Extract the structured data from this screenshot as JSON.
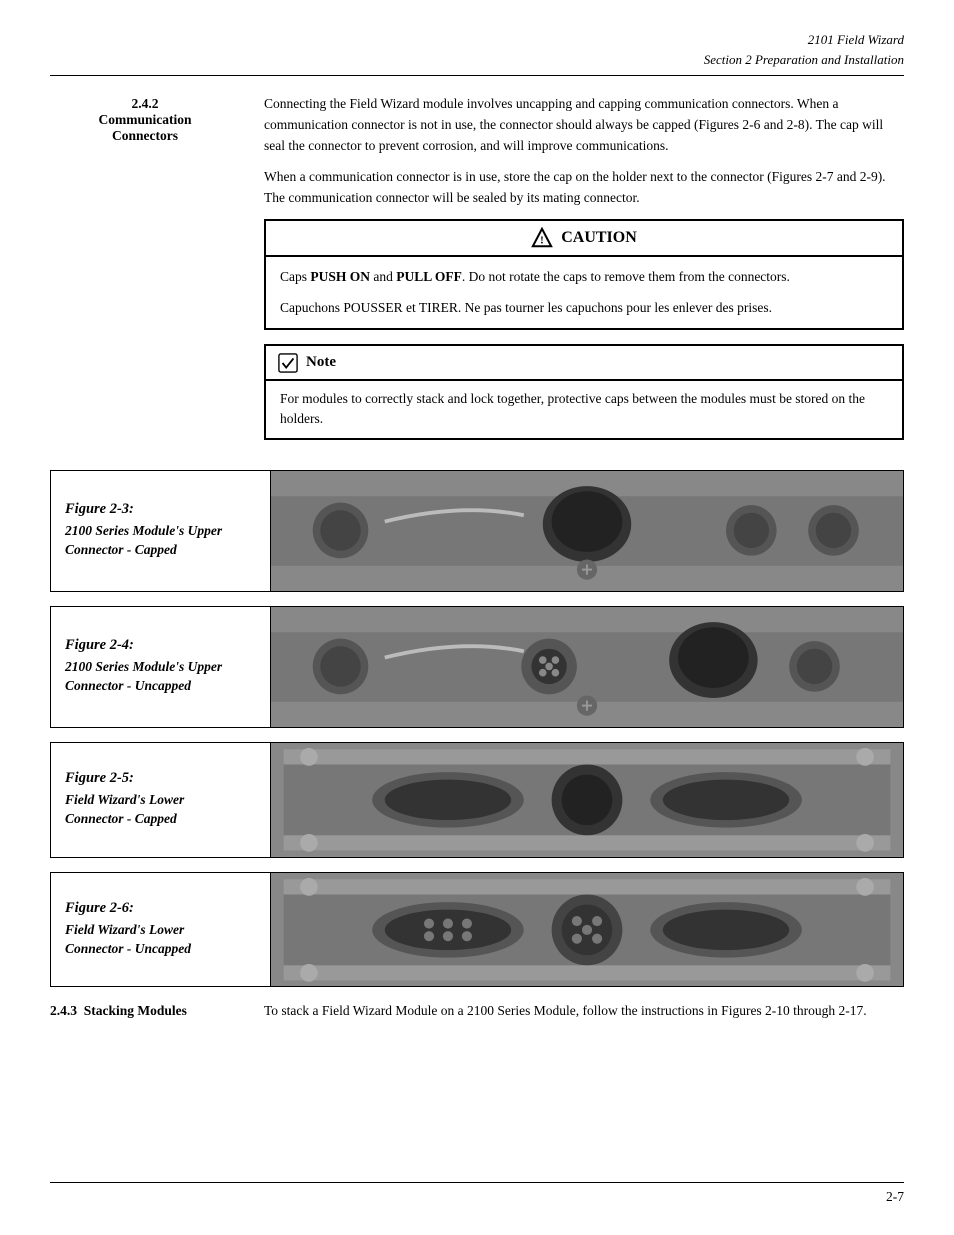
{
  "header": {
    "line1": "2101 Field Wizard",
    "line2": "Section 2   Preparation and Installation"
  },
  "section": {
    "number": "2.4.2",
    "title": "Communication\nConnectors",
    "paragraph1": "Connecting the Field Wizard module involves uncapping and capping communication connectors. When a communication connector is not in use, the connector should always be capped (Figures 2-6 and 2-8). The cap will seal the connector to prevent corrosion, and will improve communications.",
    "paragraph2": "When a communication connector is in use, store the cap on the holder next to the connector (Figures 2-7 and 2-9). The communication connector will be sealed by its mating connector."
  },
  "caution": {
    "header": "CAUTION",
    "text1_prefix": "Caps ",
    "push_on": "PUSH ON",
    "text1_middle": " and ",
    "pull_off": "PULL OFF",
    "text1_suffix": ". Do not rotate the caps to remove them from the connectors.",
    "text2": "Capuchons POUSSER et TIRER. Ne pas tourner les capuchons pour les enlever des prises."
  },
  "note": {
    "header": "Note",
    "text": "For modules to correctly stack and lock together, protective caps between the modules must be stored on the holders."
  },
  "figures": [
    {
      "id": "fig2-3",
      "title": "Figure 2-3:",
      "subtitle": "2100 Series Module’s Upper\nConnector - Capped",
      "type": "capped-upper"
    },
    {
      "id": "fig2-4",
      "title": "Figure 2-4:",
      "subtitle": "2100 Series Module’s Upper\nConnector - Uncapped",
      "type": "uncapped-upper"
    },
    {
      "id": "fig2-5",
      "title": "Figure 2-5:",
      "subtitle": "Field Wizard’s Lower\nConnector - Capped",
      "type": "capped-lower"
    },
    {
      "id": "fig2-6",
      "title": "Figure 2-6:",
      "subtitle": "Field Wizard’s Lower\nConnector - Uncapped",
      "type": "uncapped-lower"
    }
  ],
  "stacking": {
    "section_number": "2.4.3",
    "title": "Stacking Modules",
    "text": "To stack a Field Wizard Module on a 2100 Series Module, follow the instructions in Figures 2-10 through 2-17."
  },
  "footer": {
    "page_number": "2-7"
  }
}
